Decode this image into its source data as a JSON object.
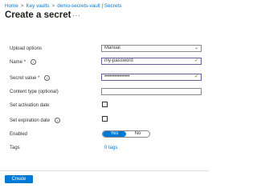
{
  "breadcrumb": {
    "home": "Home",
    "key_vaults": "Key vaults",
    "current": "demo-secrets-vault | Secrets",
    "separator": ">"
  },
  "page": {
    "title": "Create a secret",
    "more": "···"
  },
  "form": {
    "upload_options": {
      "label": "Upload options",
      "value": "Manual"
    },
    "name": {
      "label": "Name",
      "required": "*",
      "value": "my-password"
    },
    "secret_value": {
      "label": "Secret value",
      "required": "*",
      "value": "•••••••••••••••"
    },
    "content_type": {
      "label": "Content type (optional)",
      "value": ""
    },
    "activation": {
      "label": "Set activation date",
      "checked": false
    },
    "expiration": {
      "label": "Set expiration date",
      "checked": false
    },
    "enabled": {
      "label": "Enabled",
      "yes": "Yes",
      "no": "No",
      "selected": "Yes"
    },
    "tags": {
      "label": "Tags",
      "link": "0 tags"
    }
  },
  "icons": {
    "info": "i",
    "chevron": "⌄",
    "check": "✓"
  },
  "footer": {
    "create_label": "Create"
  },
  "colors": {
    "accent": "#0078d4",
    "valid_border": "#6b5d9a",
    "check_green": "#107c10"
  }
}
